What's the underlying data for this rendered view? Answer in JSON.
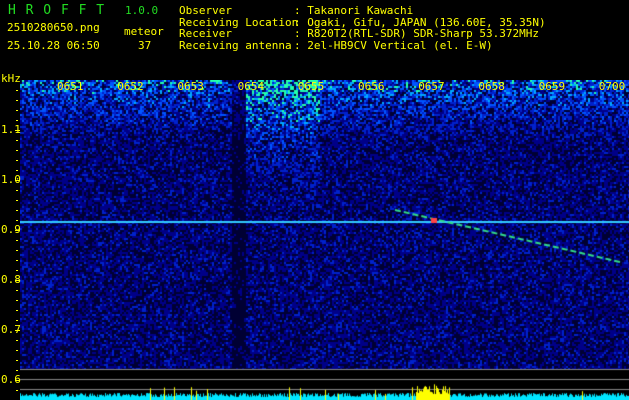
{
  "header": {
    "app_name": "H R O F F T",
    "version": "1.0.0",
    "filename": "2510280650.png",
    "datetime": "25.10.28 06:50",
    "meteor_label": "meteor",
    "meteor_count": "37",
    "info": [
      {
        "label": "Observer",
        "value": ": Takanori Kawachi"
      },
      {
        "label": "Receiving Location",
        "value": ": Ogaki, Gifu, JAPAN (136.60E, 35.35N)"
      },
      {
        "label": "Receiver",
        "value": ": R820T2(RTL-SDR) SDR-Sharp 53.372MHz"
      },
      {
        "label": "Receiving antenna",
        "value": ": 2el-HB9CV Vertical (el. E-W)"
      }
    ]
  },
  "chart_data": {
    "type": "heatmap",
    "ylabel": "kHz",
    "ylim": [
      0.58,
      1.2
    ],
    "y_ticks": [
      "1.1",
      "1.0",
      "0.9",
      "0.8",
      "0.7",
      "0.6"
    ],
    "x_ticks": [
      "0651",
      "0652",
      "0653",
      "0654",
      "0655",
      "0656",
      "0657",
      "0658",
      "0659",
      "0700"
    ],
    "carrier_khz": 0.915,
    "colors": {
      "low": "#000066",
      "mid": "#0033ff",
      "high": "#00ffaa",
      "axis": "#ffff00",
      "carrier": "#33ccff",
      "amplitude": "#00e5ff",
      "burst": "#ffff00"
    }
  }
}
